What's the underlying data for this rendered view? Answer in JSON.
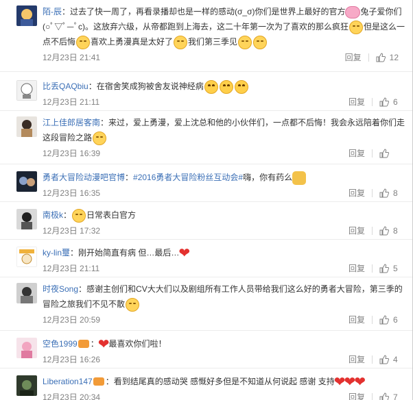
{
  "comments": [
    {
      "user": "陌-辰",
      "text": "：过去了快一周了，再看录播却也是一样的感动(σ_σ)你们是世界上最好的官方",
      "text2": "兔子爱你们(○ﾟ▽ﾟ—ﾟc)。这放弃六级，从帝都跑到上海去，这二十年第一次为了喜欢的那么疯狂",
      "text3": "但是这么一点不后悔",
      "text4": "喜欢上勇漫真是太好了",
      "text5": "我们第三季见",
      "time": "12月23日 21:41",
      "reply": "回复",
      "likes": "12"
    },
    {
      "user": "比丢QAQbiu",
      "text": "：在宿舍笑成狗被舍友说神经病",
      "time": "12月23日 21:11",
      "reply": "回复",
      "likes": "6"
    },
    {
      "user": "江上佳郎居客南",
      "text": "：来过，爱上勇漫，爱上沈总和他的小伙伴们，一点都不后悔！我会永远陪着你们走这段冒险之路",
      "time": "12月23日 16:39",
      "reply": "回复",
      "likes": ""
    },
    {
      "user": "勇者大冒险动漫吧官博",
      "text": "：",
      "hashtag": "#2016勇者大冒险粉丝互动会#",
      "text2": "嗨，你有药么",
      "time": "12月23日 16:35",
      "reply": "回复",
      "likes": "8"
    },
    {
      "user": "南极k",
      "text": "：",
      "text2": "日常表白官方",
      "time": "12月23日 17:32",
      "reply": "回复",
      "likes": "8"
    },
    {
      "user": "ky-lin璽",
      "text": "：刚开始简直有病 但…最后…",
      "time": "12月23日 21:11",
      "reply": "回复",
      "likes": "5"
    },
    {
      "user": "时夜Song",
      "text": "：感谢主创们和CV大大们以及剧组所有工作人员带给我们这么好的勇者大冒险，第三季的冒险之旅我们不见不散",
      "time": "12月23日 20:59",
      "reply": "回复",
      "likes": "6"
    },
    {
      "user": "空色1999",
      "text": "：",
      "text2": "最喜欢你们啦！",
      "time": "12月23日 16:26",
      "reply": "回复",
      "likes": "4"
    },
    {
      "user": "Liberation147",
      "text": "：看到结尾真的感动哭 感慨好多但是不知道从何说起 感谢 支持",
      "time": "12月23日 20:34",
      "reply": "回复",
      "likes": "7"
    }
  ]
}
